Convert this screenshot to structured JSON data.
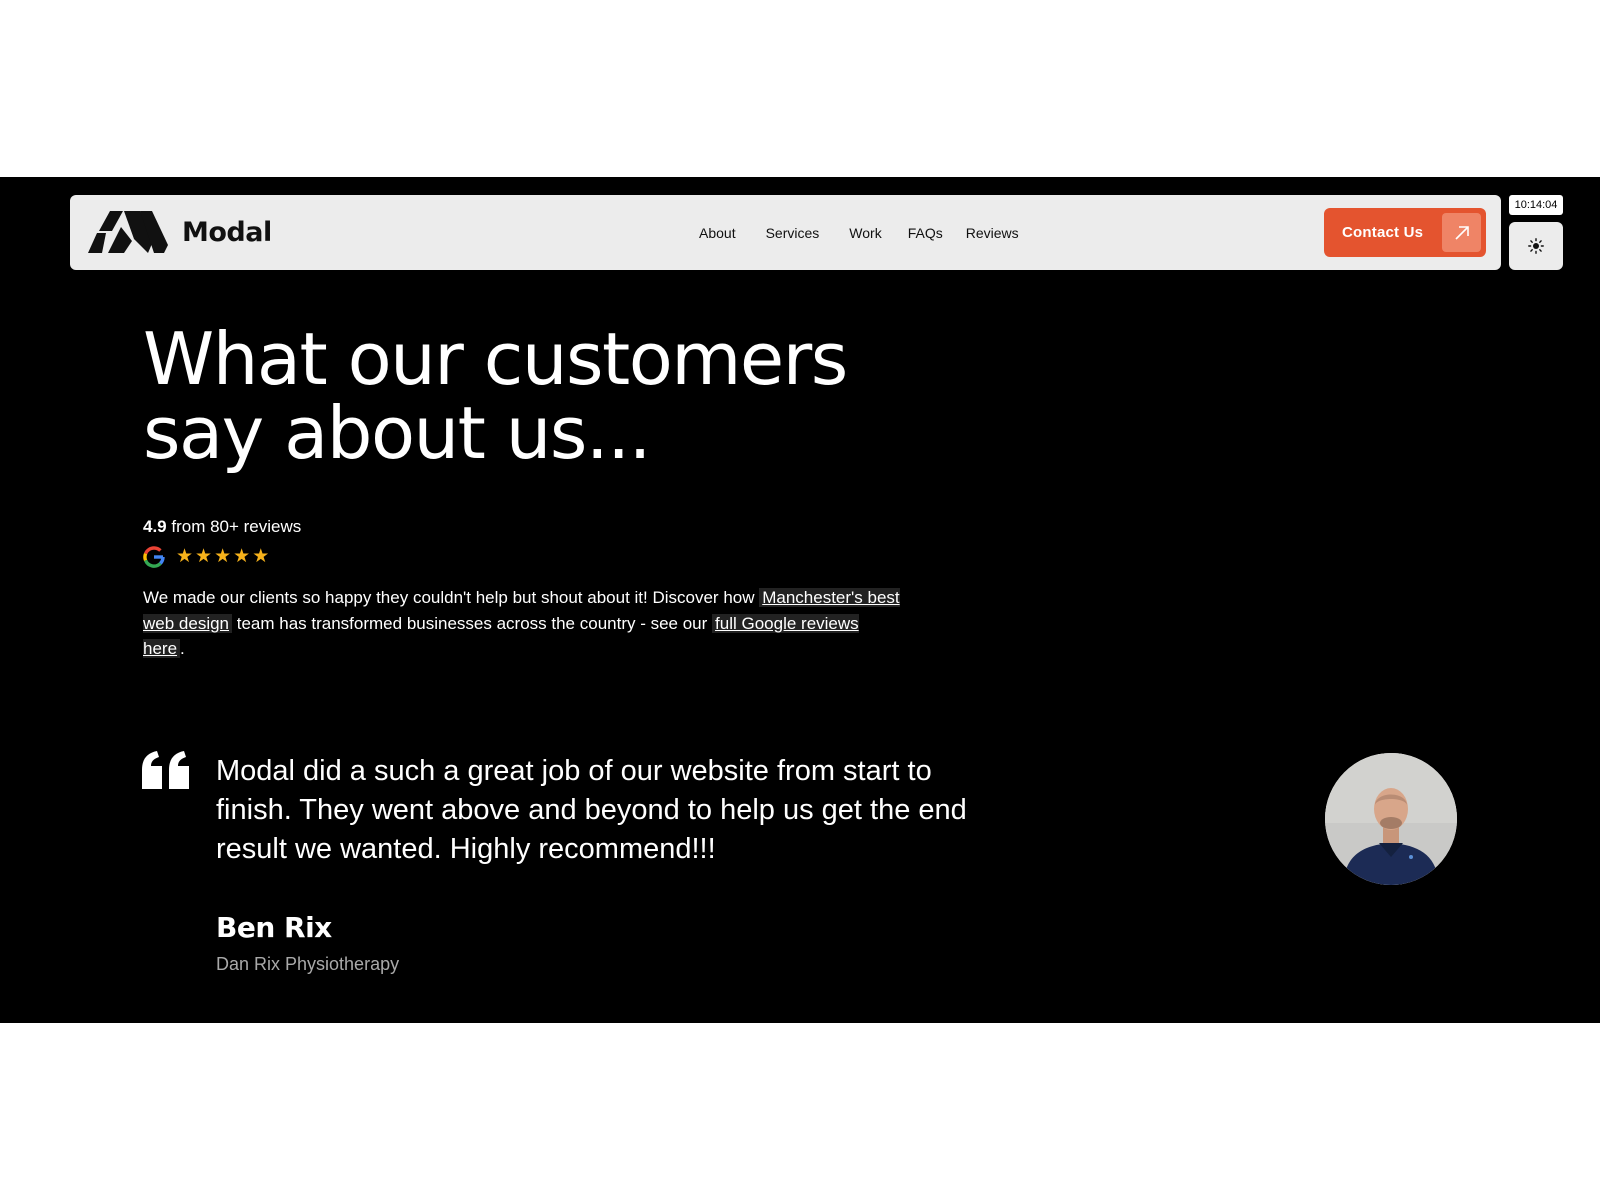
{
  "header": {
    "brand": "Modal",
    "nav": {
      "about": "About",
      "services": "Services",
      "work": "Work",
      "faqs": "FAQs",
      "reviews": "Reviews"
    },
    "contact_label": "Contact Us",
    "clock": "10:14:04"
  },
  "hero": {
    "headline_line1": "What our customers",
    "headline_line2": "say about us...",
    "rating_value": "4.9",
    "rating_suffix": " from 80+ reviews",
    "star_count": 5,
    "blurb": {
      "text1": "We made our clients so happy they couldn't help but shout about it! Discover how ",
      "link1": "Manchester's best web design",
      "text2": " team has transformed businesses across the country - see our ",
      "link2": "full Google reviews here",
      "text3": "."
    }
  },
  "testimonial": {
    "quote": "Modal did a such a great job of our website from start to finish. They went above and beyond to help us get the end result we wanted. Highly recommend!!!",
    "author": "Ben Rix",
    "company": "Dan Rix Physiotherapy"
  },
  "colors": {
    "accent": "#e4542f",
    "star": "#f6b21b",
    "background": "#000000",
    "navbar": "#ececec"
  },
  "icons": [
    "modal-logo-icon",
    "arrow-up-right-icon",
    "sun-icon",
    "google-g-icon",
    "star-icon",
    "quote-icon",
    "avatar-photo"
  ]
}
